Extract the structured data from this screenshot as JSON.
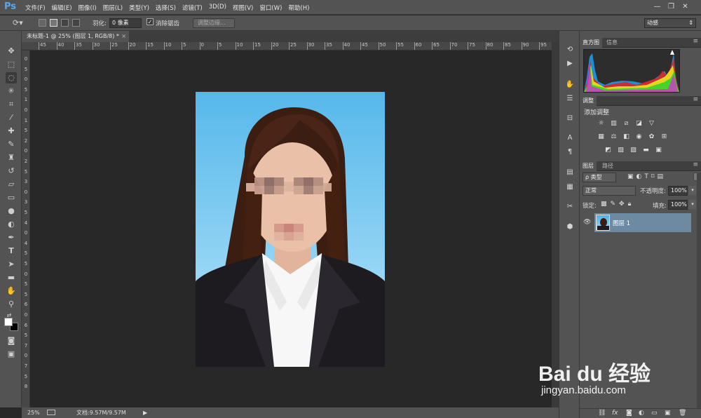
{
  "app": {
    "logo": "Ps"
  },
  "menu": [
    "文件(F)",
    "编辑(E)",
    "图像(I)",
    "图层(L)",
    "类型(Y)",
    "选择(S)",
    "滤镜(T)",
    "3D(D)",
    "视图(V)",
    "窗口(W)",
    "帮助(H)"
  ],
  "window_controls": {
    "minimize": "—",
    "restore": "❐",
    "close": "✕"
  },
  "options": {
    "feather_label": "羽化:",
    "feather_value": "0 像素",
    "antialias_label": "消除锯齿",
    "antialias_checked": true,
    "refine_edge_label": "调整边缘...",
    "workspace_value": "动感"
  },
  "document": {
    "tab_title": "未标题-1 @ 25% (图层 1, RGB/8) *",
    "tab_close": "×",
    "ruler_top_labels": [
      "45",
      "40",
      "35",
      "30",
      "25",
      "20",
      "15",
      "10",
      "5",
      "0",
      "5",
      "10",
      "15",
      "20",
      "25",
      "30",
      "35",
      "40",
      "45",
      "50",
      "55",
      "60",
      "65",
      "70",
      "75",
      "80",
      "85",
      "90",
      "95"
    ],
    "ruler_left_labels": [
      "0",
      "5",
      "0",
      "5",
      "1",
      "0",
      "1",
      "5",
      "2",
      "0",
      "2",
      "5",
      "3",
      "0",
      "3",
      "5",
      "4",
      "0",
      "4",
      "5",
      "5",
      "0",
      "5",
      "5",
      "6",
      "0",
      "6",
      "5",
      "7",
      "0",
      "7",
      "5",
      "8"
    ]
  },
  "status": {
    "zoom": "25%",
    "doc_info": "文档:9.57M/9.57M"
  },
  "panels": {
    "histogram": {
      "tabs": [
        "直方图",
        "信息"
      ]
    },
    "adjustments": {
      "tab": "调整",
      "title": "添加调整"
    },
    "layers": {
      "tabs": [
        "图层",
        "路径"
      ],
      "filter_kind": "ρ 类型",
      "blend_mode": "正常",
      "opacity_label": "不透明度:",
      "opacity_value": "100%",
      "lock_label": "锁定:",
      "fill_label": "填充:",
      "fill_value": "100%",
      "layer_name": "图层 1",
      "footer_icons": [
        "link-icon",
        "fx-icon",
        "mask-icon",
        "adjustment-icon",
        "group-icon",
        "new-layer-icon",
        "trash-icon"
      ]
    }
  },
  "watermark": {
    "brand": "Bai du 经验",
    "url": "jingyan.baidu.com"
  },
  "colors": {
    "accent": "#5aa8e8",
    "selected_layer": "#6d8aa3",
    "ui_gray": "#535353",
    "canvas_bg": "#282828"
  }
}
